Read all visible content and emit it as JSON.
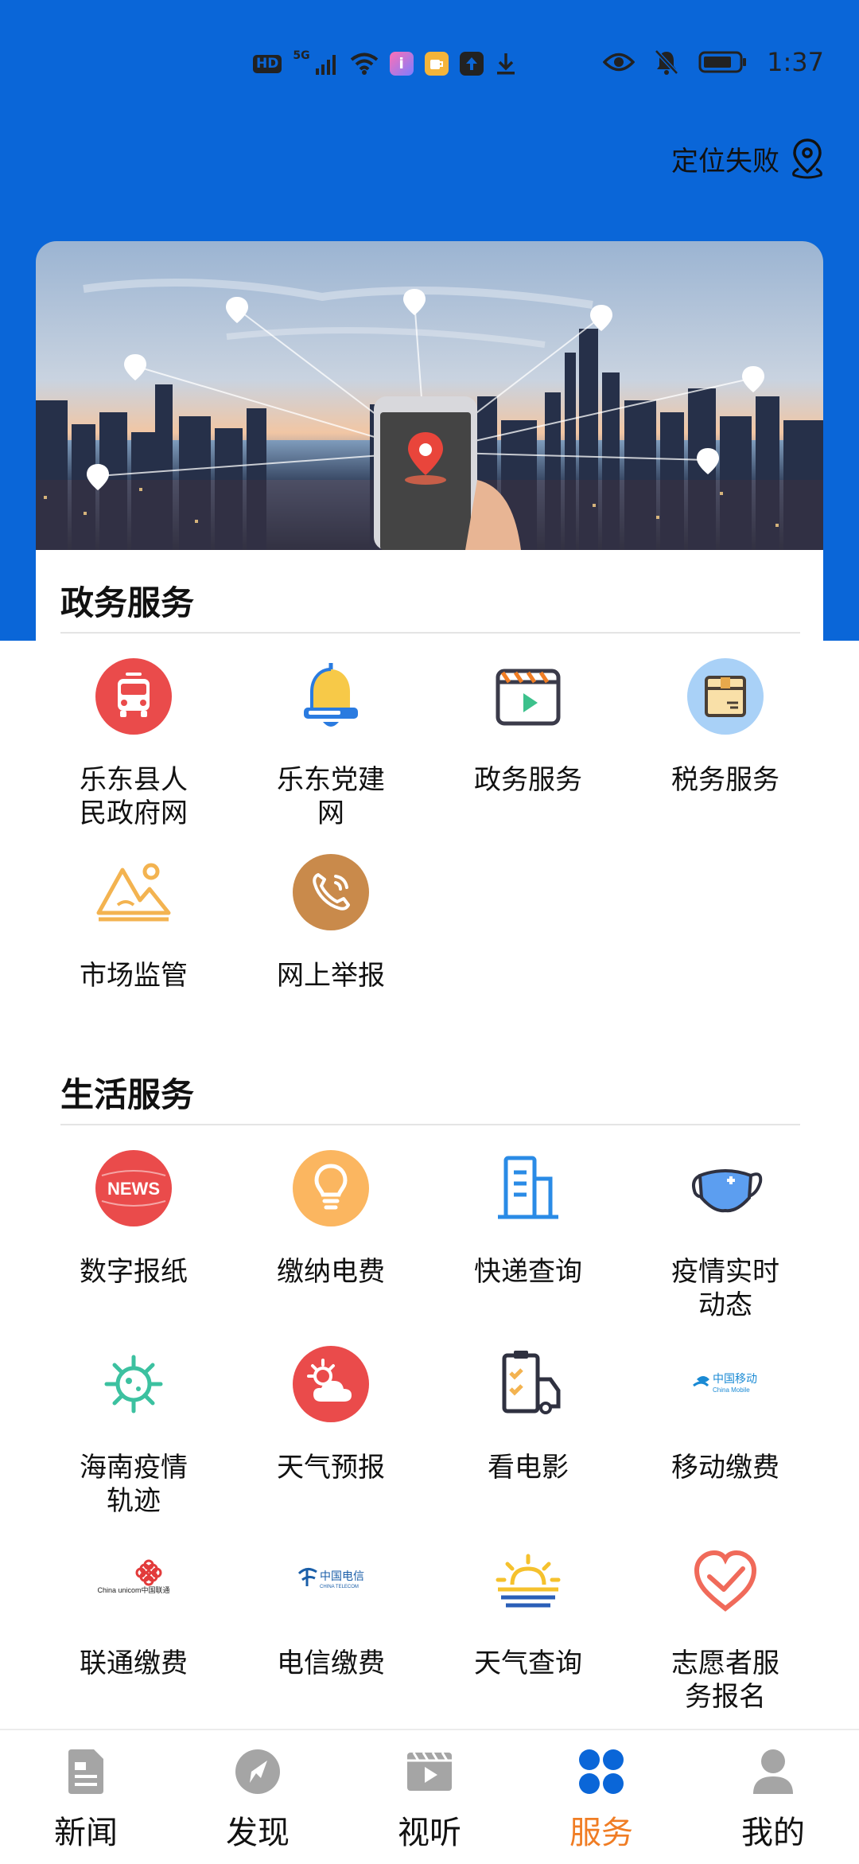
{
  "status_bar": {
    "network": "HD",
    "signal": "5G",
    "time": "1:37"
  },
  "header": {
    "location_text": "定位失败"
  },
  "gov_section": {
    "title": "政务服务",
    "items": [
      {
        "label": "乐东县人民政府网",
        "icon": "bus-icon"
      },
      {
        "label": "乐东党建网",
        "icon": "bell-icon"
      },
      {
        "label": "政务服务",
        "icon": "video-player-icon"
      },
      {
        "label": "税务服务",
        "icon": "package-icon"
      },
      {
        "label": "市场监管",
        "icon": "mountain-icon"
      },
      {
        "label": "网上举报",
        "icon": "phone-icon"
      }
    ]
  },
  "life_section": {
    "title": "生活服务",
    "items": [
      {
        "label": "数字报纸",
        "icon": "news-icon",
        "badge_text": "NEWS"
      },
      {
        "label": "缴纳电费",
        "icon": "lightbulb-icon"
      },
      {
        "label": "快递查询",
        "icon": "building-icon"
      },
      {
        "label": "疫情实时动态",
        "icon": "mask-icon"
      },
      {
        "label": "海南疫情轨迹",
        "icon": "virus-icon"
      },
      {
        "label": "天气预报",
        "icon": "weather-icon"
      },
      {
        "label": "看电影",
        "icon": "delivery-checklist-icon"
      },
      {
        "label": "移动缴费",
        "icon": "china-mobile-logo",
        "logo_text": "中国移动",
        "logo_sub": "China Mobile"
      },
      {
        "label": "联通缴费",
        "icon": "china-unicom-logo",
        "logo_text": "China unicom中国联通"
      },
      {
        "label": "电信缴费",
        "icon": "china-telecom-logo",
        "logo_text": "中国电信",
        "logo_sub": "CHINA TELECOM"
      },
      {
        "label": "天气查询",
        "icon": "sunrise-icon"
      },
      {
        "label": "志愿者服务报名",
        "icon": "heart-hand-icon"
      }
    ]
  },
  "bottom_nav": {
    "items": [
      {
        "label": "新闻",
        "icon": "news-doc-icon"
      },
      {
        "label": "发现",
        "icon": "compass-icon"
      },
      {
        "label": "视听",
        "icon": "video-icon"
      },
      {
        "label": "服务",
        "icon": "grid-icon"
      },
      {
        "label": "我的",
        "icon": "user-icon"
      }
    ],
    "active": "服务"
  },
  "colors": {
    "header_blue": "#0a66d8",
    "active_tab": "#f07d24"
  }
}
